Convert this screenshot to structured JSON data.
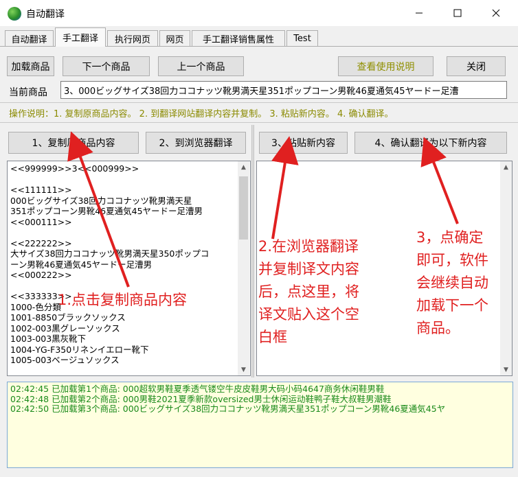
{
  "window": {
    "title": "自动翻译"
  },
  "tabs": [
    "自动翻译",
    "手工翻译",
    "执行网页",
    "网页",
    "手工翻译销售属性",
    "Test"
  ],
  "toolbar": {
    "load_label": "加载商品",
    "next_label": "下一个商品",
    "prev_label": "上一个商品",
    "help_label": "查看使用说明",
    "close_label": "关闭"
  },
  "current_item": {
    "label": "当前商品",
    "value": "3、000ビッグサイズ38回力ココナッツ靴男満天星351ポップコーン男靴46夏通気45ヤードー足漕"
  },
  "instructions": "操作说明：1. 复制原商品内容。 2. 到翻译网站翻译内容并复制。 3. 粘贴新内容。 4. 确认翻译。",
  "steps": {
    "copy_label": "1、复制原商品内容",
    "browser_label": "2、到浏览器翻译",
    "paste_label": "3、粘贴新内容",
    "confirm_label": "4、确认翻译为以下新内容"
  },
  "source_text": "<<999999>>3<<000999>>\n\n<<111111>>\n000ビッグサイズ38回力ココナッツ靴男満天星\n351ポップコーン男靴46夏通気45ヤードー足漕男\n<<000111>>\n\n<<222222>>\n大サイズ38回力ココナッツ靴男満天星350ポップコ\nーン男靴46夏通気45ヤードー足漕男\n<<000222>>\n\n<<333333>>\n1000-色分類\n1001-8850ブラックソックス\n1002-003黒グレーソックス\n1003-003黒灰靴下\n1004-YG-F350リネンイエロー靴下\n1005-003ベージュソックス",
  "log": [
    "02:42:45 已加载第1个商品: 000超软男鞋夏季透气镂空牛皮皮鞋男大码小码4647商务休闲鞋男鞋",
    "02:42:48 已加载第2个商品: 000男鞋2021夏季新款oversized男士休闲运动鞋鸭子鞋大叔鞋男潮鞋",
    "02:42:50 已加载第3个商品: 000ビッグサイズ38回力ココナッツ靴男満天星351ポップコーン男靴46夏通気45ヤ"
  ],
  "annotations": {
    "a1": "1.点击复制商品内容",
    "a2": [
      "2.在浏览器翻译",
      "并复制译文内容",
      "后，点这里，将",
      "译文贴入这个空",
      "白框"
    ],
    "a3": [
      "3，点确定",
      "即可，软件",
      "会继续自动",
      "加载下一个",
      "商品。"
    ]
  },
  "colors": {
    "annotation": "#e02020",
    "log_text": "#1a8a1a",
    "instruction": "#8a8a00",
    "log_bg": "#ffffe0"
  }
}
